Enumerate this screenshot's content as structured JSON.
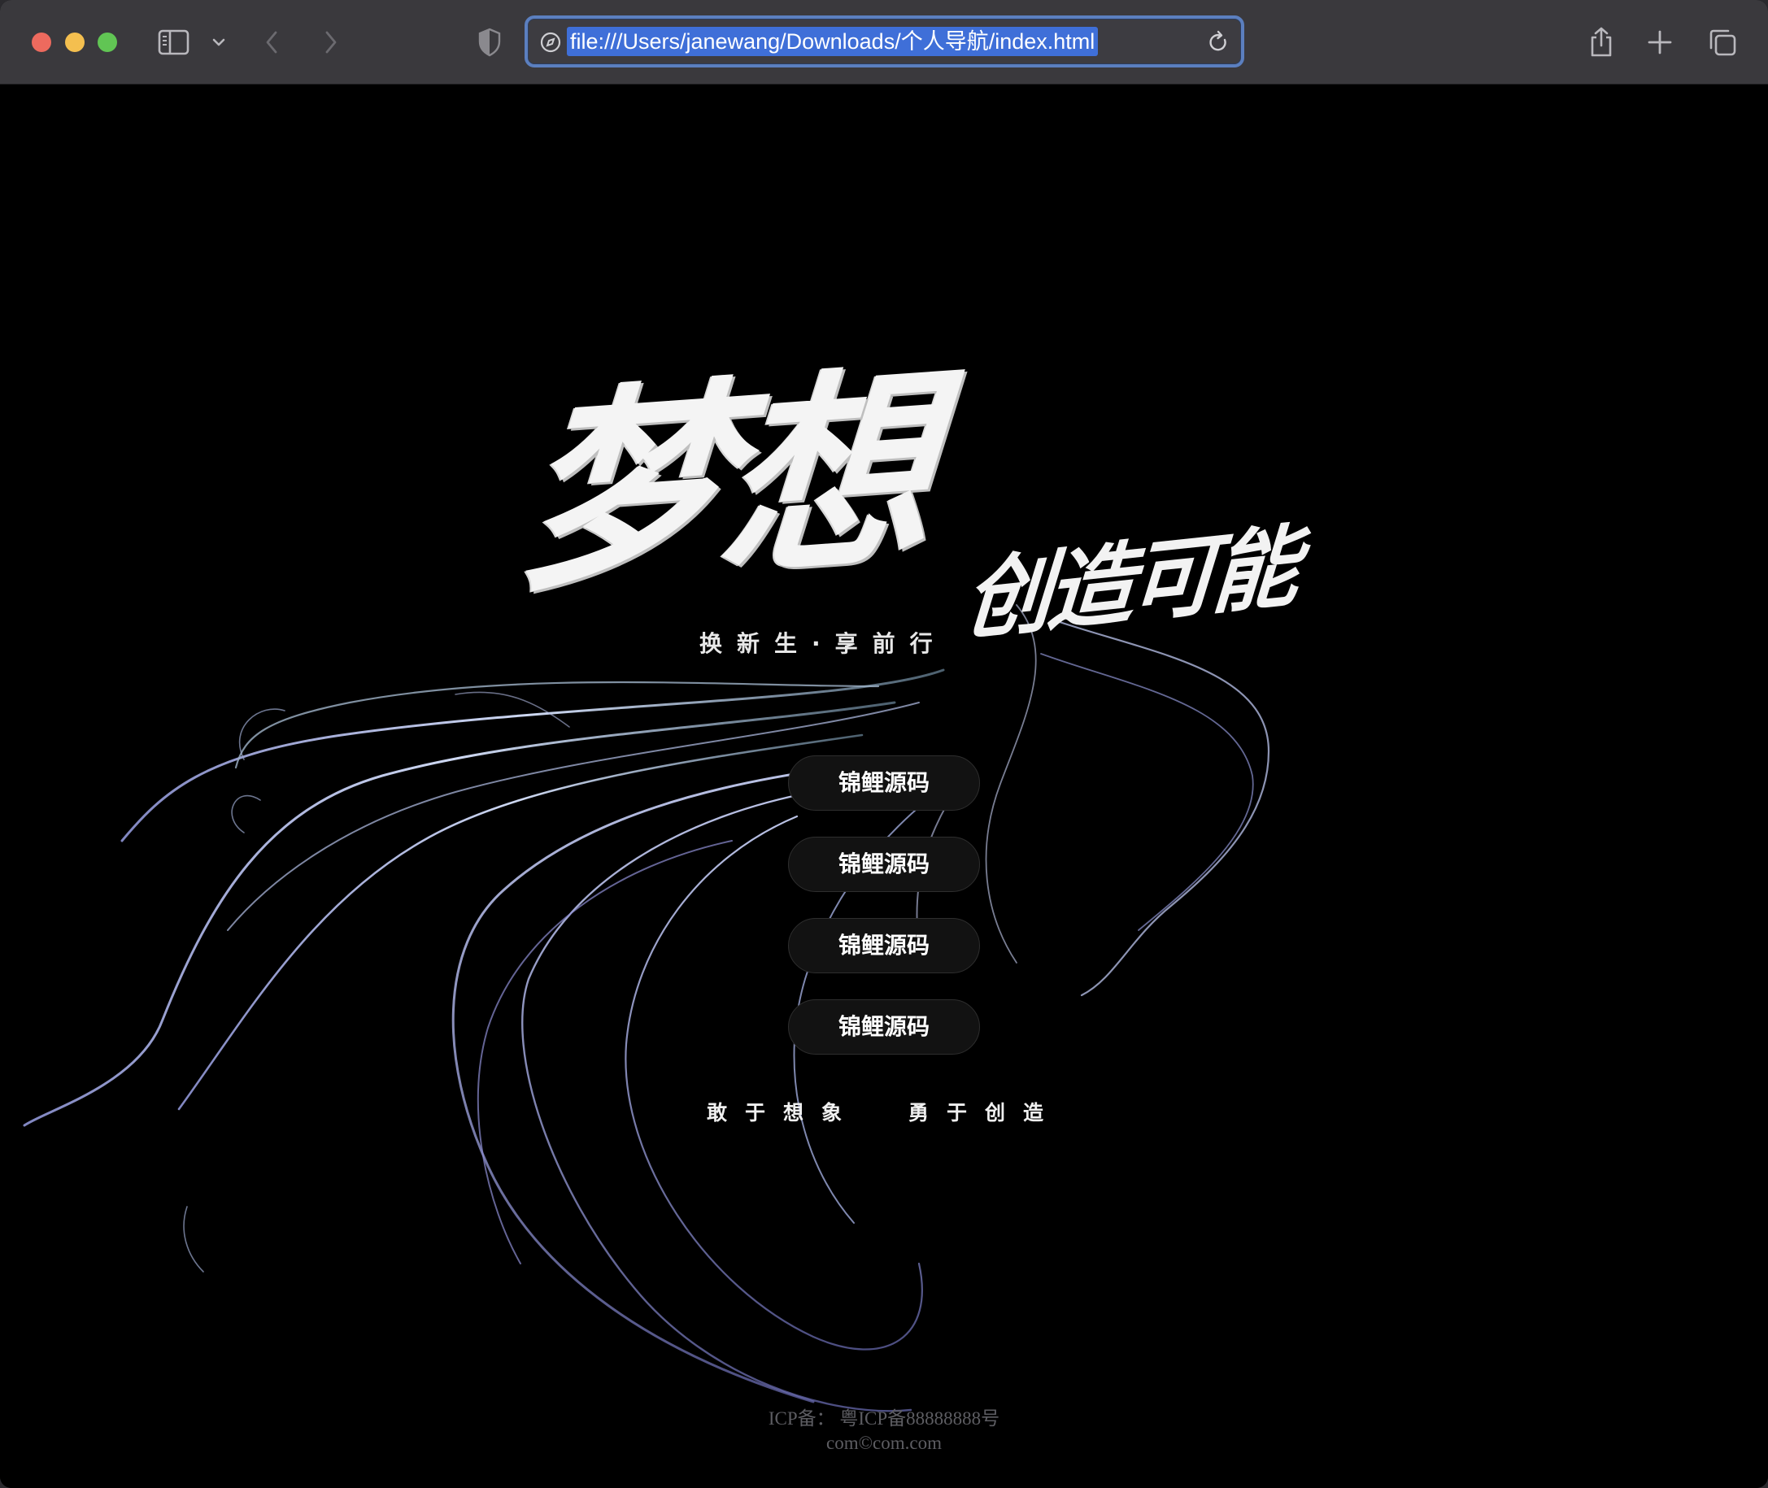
{
  "browser": {
    "url": "file:///Users/janewang/Downloads/个人导航/index.html",
    "icons": {
      "close": "close-icon",
      "minimize": "minimize-icon",
      "zoom": "zoom-icon",
      "sidebar": "sidebar-icon",
      "sidebar_menu": "chevron-down-icon",
      "back": "chevron-left-icon",
      "forward": "chevron-right-icon",
      "privacy": "shield-icon",
      "page": "compass-icon",
      "reload": "reload-icon",
      "share": "share-icon",
      "new_tab": "plus-icon",
      "tab_overview": "tabs-icon"
    },
    "colors": {
      "toolbar": "#3a393d",
      "url_focus": "#5b7fbf",
      "url_selection": "#3f6fd8"
    }
  },
  "hero": {
    "title": "梦想",
    "subtitle": "创造可能",
    "tagline": "换新生·享前行"
  },
  "nav": {
    "buttons": [
      {
        "label": "锦鲤源码"
      },
      {
        "label": "锦鲤源码"
      },
      {
        "label": "锦鲤源码"
      },
      {
        "label": "锦鲤源码"
      }
    ]
  },
  "slogan": {
    "left": "敢于想象",
    "right": "勇于创造"
  },
  "footer": {
    "icp": "ICP备： 粤ICP备88888888号",
    "copyright": "com©com.com"
  },
  "colors": {
    "background": "#000000",
    "text": "#ffffff",
    "button_bg": "#121212",
    "footer_text": "#5d5d62"
  }
}
